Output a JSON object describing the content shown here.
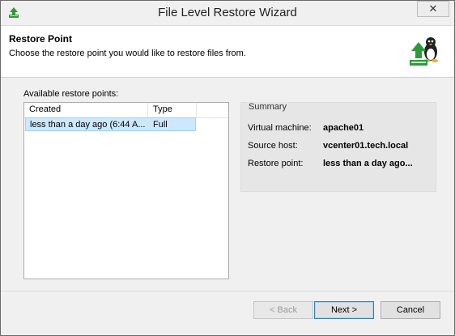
{
  "window": {
    "title": "File Level Restore Wizard",
    "close_glyph": "✕"
  },
  "header": {
    "title": "Restore Point",
    "description": "Choose the restore point you would like to restore files from."
  },
  "restore_points": {
    "label": "Available restore points:",
    "columns": [
      "Created",
      "Type"
    ],
    "rows": [
      {
        "created": "less than a day ago (6:44 A...",
        "type": "Full"
      }
    ]
  },
  "summary": {
    "title": "Summary",
    "vm_label": "Virtual machine:",
    "vm_value": "apache01",
    "host_label": "Source host:",
    "host_value": "vcenter01.tech.local",
    "point_label": "Restore point:",
    "point_value": "less than a day ago..."
  },
  "buttons": {
    "back": "< Back",
    "next": "Next >",
    "cancel": "Cancel"
  },
  "icons": {
    "title_icon": "veeam-restore-icon",
    "header_icon": "linux-restore-icon"
  },
  "colors": {
    "selection": "#cce8ff",
    "accent_green": "#2e9b3a"
  }
}
